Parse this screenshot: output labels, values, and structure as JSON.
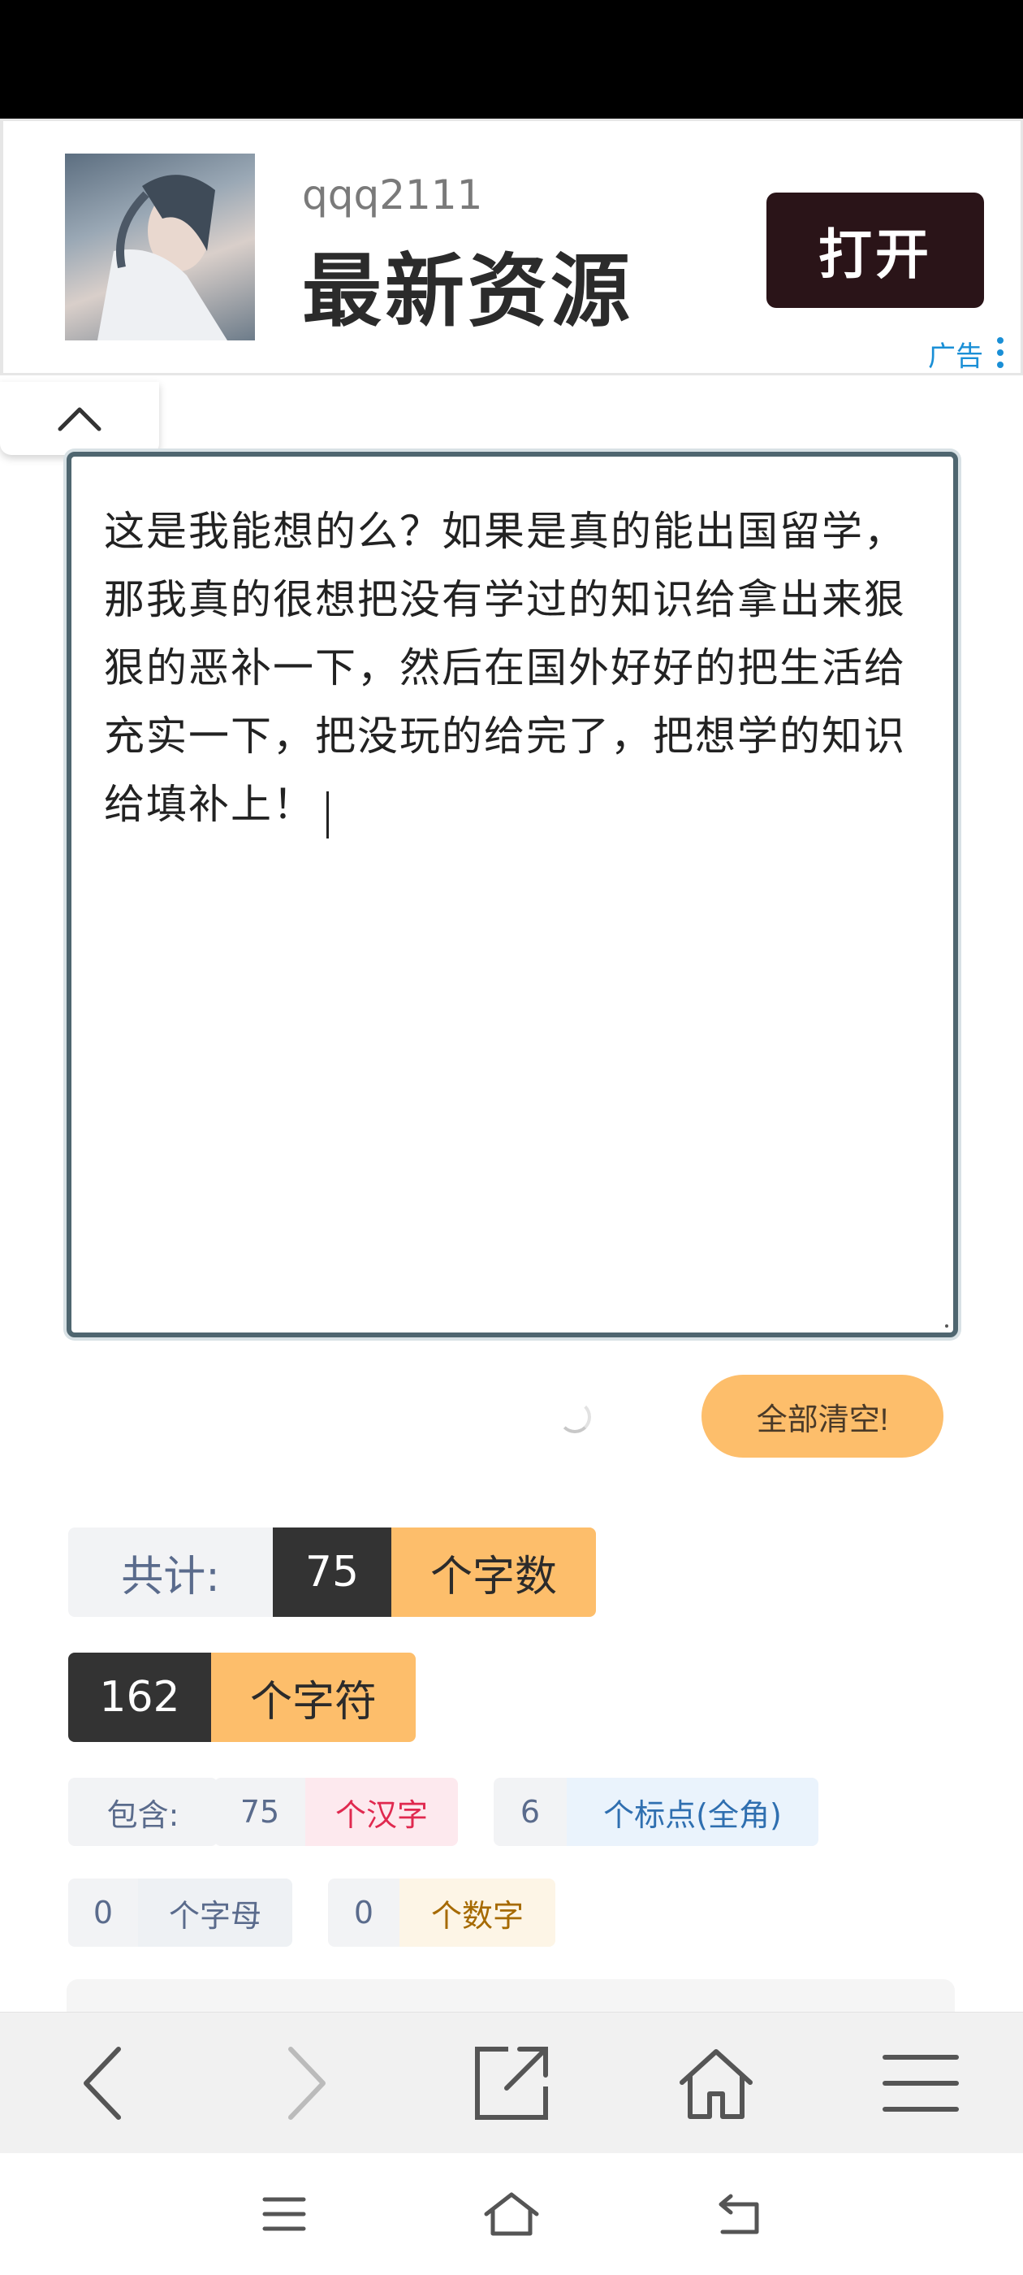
{
  "ad": {
    "username": "qqq2111",
    "title": "最新资源",
    "open_label": "打开",
    "tag": "广告"
  },
  "editor": {
    "text": "这是我能想的么？如果是真的能出国留学，那我真的很想把没有学过的知识给拿出来狠狠的恶补一下，然后在国外好好的把生活给充实一下，把没玩的给完了，把想学的知识给填补上！"
  },
  "actions": {
    "clear_label": "全部清空!"
  },
  "stats": {
    "total_label": "共计:",
    "word_count": "75",
    "word_unit": "个字数",
    "char_count": "162",
    "char_unit": "个字符",
    "contains_label": "包含:",
    "hanzi_count": "75",
    "hanzi_unit": "个汉字",
    "punct_count": "6",
    "punct_unit": "个标点(全角)",
    "letter_count": "0",
    "letter_unit": "个字母",
    "digit_count": "0",
    "digit_unit": "个数字"
  },
  "colors": {
    "accent_orange": "#fdbe6b",
    "dark_segment": "#333333",
    "ad_button": "#2a1418",
    "editor_border": "#4f6670"
  },
  "icons": {
    "toolbar": [
      "back-icon",
      "forward-icon",
      "share-icon",
      "home-icon",
      "menu-icon"
    ],
    "system": [
      "recent-apps-icon",
      "system-home-icon",
      "system-back-icon"
    ]
  }
}
